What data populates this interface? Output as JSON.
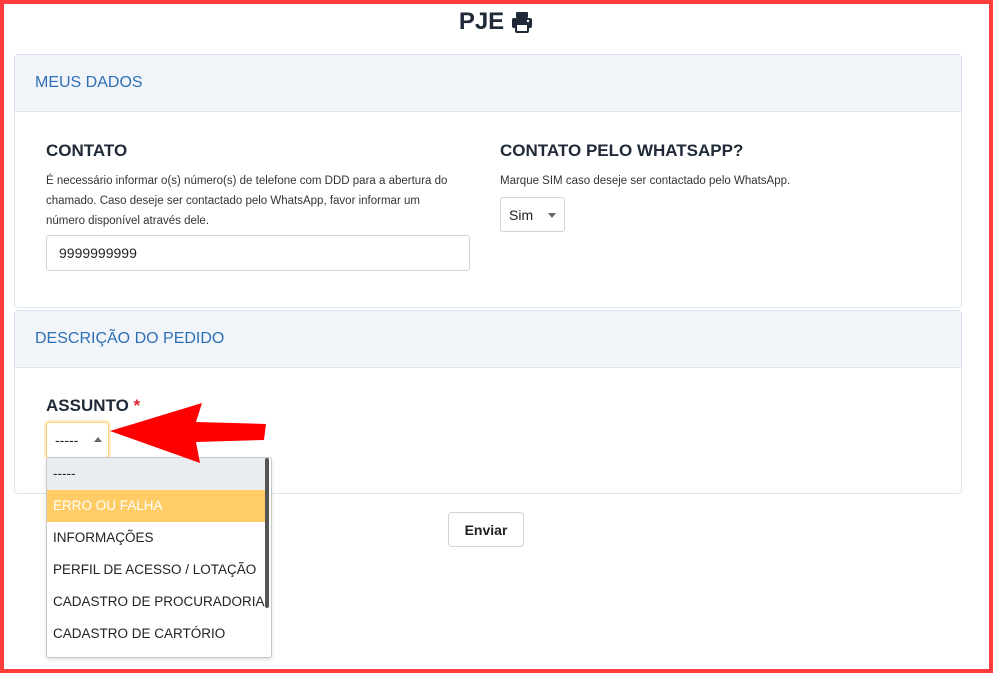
{
  "page": {
    "title": "PJE"
  },
  "icons": {
    "title_icon": "printer-icon",
    "annotation": "red-arrow-icon"
  },
  "colors": {
    "frame": "#ff3b3b",
    "header_text": "#2f6fb5",
    "selected_option": "#ffcc66",
    "required": "#e0262d"
  },
  "meus_dados": {
    "header": "MEUS DADOS",
    "contato": {
      "title": "CONTATO",
      "help_line1": "É necessário informar o(s) número(s) de telefone com DDD para a abertura do",
      "help_line2": "chamado. Caso deseje ser contactado pelo WhatsApp, favor informar um",
      "help_line3": "número disponível através dele.",
      "value": "9999999999"
    },
    "whatsapp": {
      "title": "CONTATO PELO WHATSAPP?",
      "help": "Marque SIM caso deseje ser contactado pelo WhatsApp.",
      "selected": "Sim"
    }
  },
  "pedido": {
    "header": "DESCRIÇÃO DO PEDIDO",
    "assunto": {
      "label": "ASSUNTO",
      "required_mark": "*",
      "selected": "-----",
      "options": [
        "-----",
        "ERRO OU FALHA",
        "INFORMAÇÕES",
        "PERFIL DE ACESSO / LOTAÇÃO",
        "CADASTRO DE PROCURADORIA",
        "CADASTRO DE CARTÓRIO"
      ]
    }
  },
  "submit": {
    "label": "Enviar"
  }
}
